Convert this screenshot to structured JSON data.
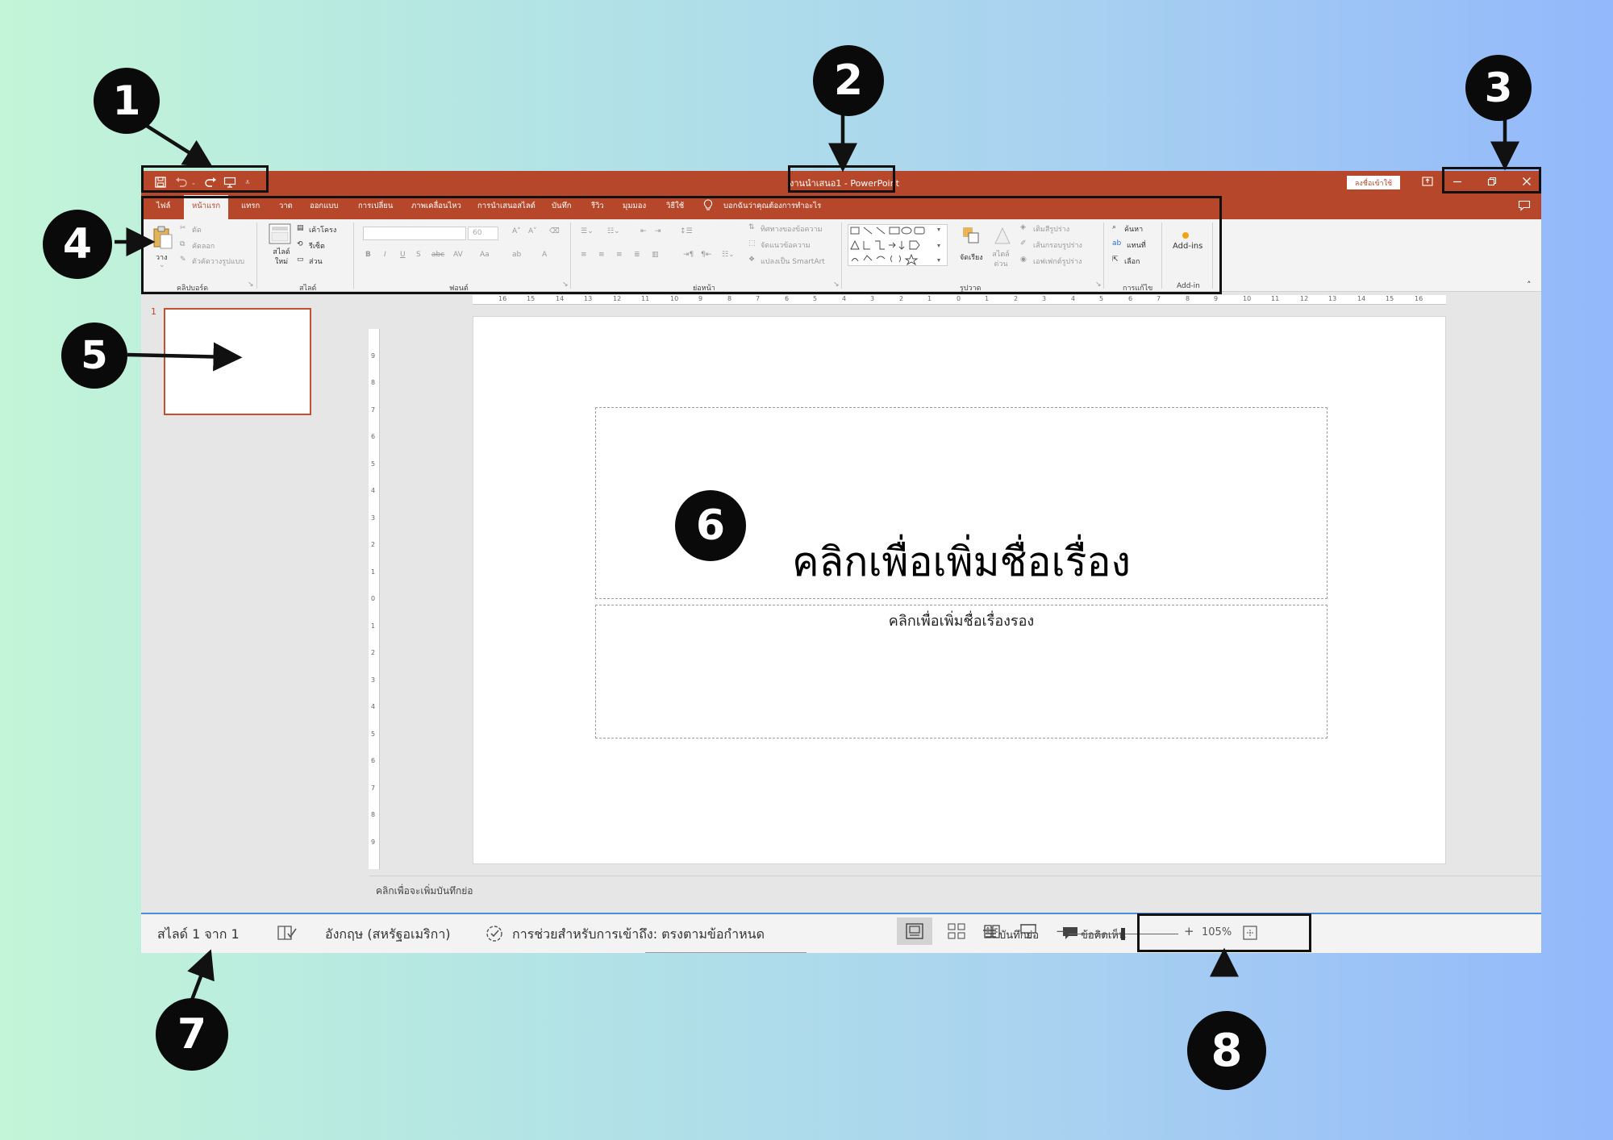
{
  "window": {
    "title": "งานนำเสนอ1 - PowerPoint",
    "signin_label": "ลงชื่อเข้าใช้"
  },
  "tabs": [
    "ไฟล์",
    "หน้าแรก",
    "แทรก",
    "วาด",
    "ออกแบบ",
    "การเปลี่ยน",
    "ภาพเคลื่อนไหว",
    "การนำเสนอสไลด์",
    "บันทึก",
    "รีวิว",
    "มุมมอง",
    "วิธีใช้"
  ],
  "tell_me": "บอกฉันว่าคุณต้องการทำอะไร",
  "ribbon": {
    "clipboard": {
      "label": "คลิปบอร์ด",
      "paste": "วาง",
      "cut": "ตัด",
      "copy": "คัดลอก",
      "format_painter": "ตัวคัดวางรูปแบบ"
    },
    "slides": {
      "label": "สไลด์",
      "new_slide": "สไลด์ใหม่",
      "layout": "เค้าโครง",
      "reset": "รีเซ็ต",
      "section": "ส่วน"
    },
    "font": {
      "label": "ฟอนต์",
      "size": "60"
    },
    "paragraph": {
      "label": "ย่อหน้า",
      "text_direction": "ทิศทางของข้อความ",
      "align_text": "จัดแนวข้อความ",
      "smartart": "แปลงเป็น SmartArt"
    },
    "drawing": {
      "label": "รูปวาด",
      "arrange": "จัดเรียง",
      "quick_styles": "สไตล์ด่วน",
      "shape_fill": "เติมสีรูปร่าง",
      "shape_outline": "เส้นกรอบรูปร่าง",
      "shape_effects": "เอฟเฟกต์รูปร่าง"
    },
    "editing": {
      "label": "การแก้ไข",
      "find": "ค้นหา",
      "replace": "แทนที่",
      "select": "เลือก"
    },
    "addins": {
      "label": "Add-in",
      "button": "Add-ins"
    }
  },
  "ruler_h": [
    "16",
    "15",
    "14",
    "13",
    "12",
    "11",
    "10",
    "9",
    "8",
    "7",
    "6",
    "5",
    "4",
    "3",
    "2",
    "1",
    "0",
    "1",
    "2",
    "3",
    "4",
    "5",
    "6",
    "7",
    "8",
    "9",
    "10",
    "11",
    "12",
    "13",
    "14",
    "15",
    "16"
  ],
  "ruler_v": [
    "9",
    "8",
    "7",
    "6",
    "5",
    "4",
    "3",
    "2",
    "1",
    "0",
    "1",
    "2",
    "3",
    "4",
    "5",
    "6",
    "7",
    "8",
    "9"
  ],
  "thumbnail": {
    "number": "1"
  },
  "slide": {
    "title_placeholder": "คลิกเพื่อเพิ่มชื่อเรื่อง",
    "subtitle_placeholder": "คลิกเพื่อเพิ่มชื่อเรื่องรอง"
  },
  "notes_placeholder": "คลิกเพื่อจะเพิ่มบันทึกย่อ",
  "status": {
    "slide_of": "สไลด์ 1 จาก 1",
    "language": "อังกฤษ (สหรัฐอเมริกา)",
    "accessibility": "การช่วยสำหรับการเข้าถึง: ตรงตามข้อกำหนด",
    "notes": "บันทึกย่อ",
    "comments": "ข้อคิดเห็น",
    "zoom": "105%"
  },
  "annotations": [
    "1",
    "2",
    "3",
    "4",
    "5",
    "6",
    "7",
    "8"
  ],
  "colors": {
    "accent": "#b7472a",
    "badge": "#0a0a0a"
  }
}
